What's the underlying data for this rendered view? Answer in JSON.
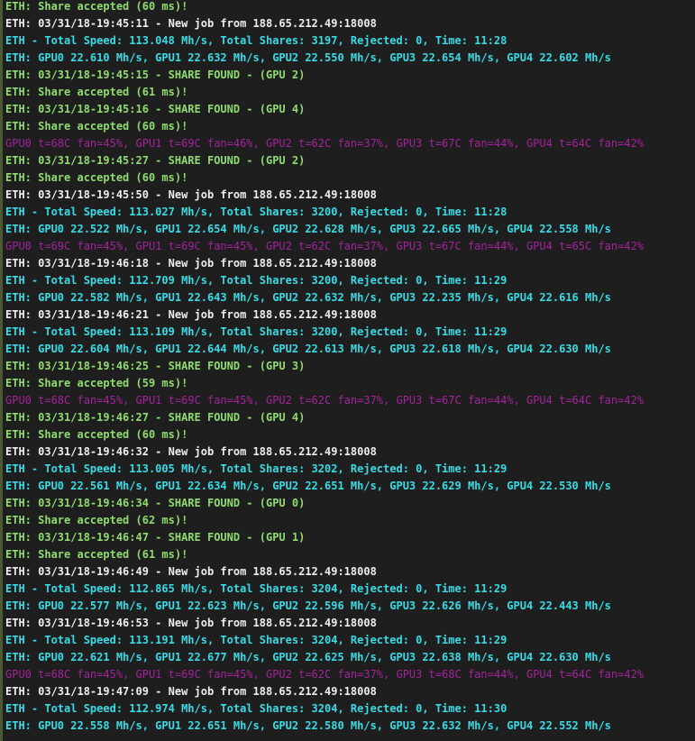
{
  "colors": {
    "background": "#1e1e1e",
    "green": "#8fdc6e",
    "white": "#eeeeee",
    "cyan": "#36dce6",
    "purple": "#a3239a"
  },
  "lines": [
    {
      "c": "green",
      "text": "ETH: Share accepted (60 ms)!"
    },
    {
      "c": "white",
      "text": "ETH: 03/31/18-19:45:11 - New job from 188.65.212.49:18008"
    },
    {
      "c": "cyan",
      "text": "ETH - Total Speed: 113.048 Mh/s, Total Shares: 3197, Rejected: 0, Time: 11:28"
    },
    {
      "c": "cyan",
      "text": "ETH: GPU0 22.610 Mh/s, GPU1 22.632 Mh/s, GPU2 22.550 Mh/s, GPU3 22.654 Mh/s, GPU4 22.602 Mh/s"
    },
    {
      "c": "green",
      "text": "ETH: 03/31/18-19:45:15 - SHARE FOUND - (GPU 2)"
    },
    {
      "c": "green",
      "text": "ETH: Share accepted (61 ms)!"
    },
    {
      "c": "green",
      "text": "ETH: 03/31/18-19:45:16 - SHARE FOUND - (GPU 4)"
    },
    {
      "c": "green",
      "text": "ETH: Share accepted (60 ms)!"
    },
    {
      "c": "purple",
      "text": "GPU0 t=68C fan=45%, GPU1 t=69C fan=46%, GPU2 t=62C fan=37%, GPU3 t=67C fan=44%, GPU4 t=64C fan=42%"
    },
    {
      "c": "green",
      "text": "ETH: 03/31/18-19:45:27 - SHARE FOUND - (GPU 2)"
    },
    {
      "c": "green",
      "text": "ETH: Share accepted (60 ms)!"
    },
    {
      "c": "white",
      "text": "ETH: 03/31/18-19:45:50 - New job from 188.65.212.49:18008"
    },
    {
      "c": "cyan",
      "text": "ETH - Total Speed: 113.027 Mh/s, Total Shares: 3200, Rejected: 0, Time: 11:28"
    },
    {
      "c": "cyan",
      "text": "ETH: GPU0 22.522 Mh/s, GPU1 22.654 Mh/s, GPU2 22.628 Mh/s, GPU3 22.665 Mh/s, GPU4 22.558 Mh/s"
    },
    {
      "c": "purple",
      "text": "GPU0 t=69C fan=45%, GPU1 t=69C fan=45%, GPU2 t=62C fan=37%, GPU3 t=67C fan=44%, GPU4 t=65C fan=42%"
    },
    {
      "c": "white",
      "text": "ETH: 03/31/18-19:46:18 - New job from 188.65.212.49:18008"
    },
    {
      "c": "cyan",
      "text": "ETH - Total Speed: 112.709 Mh/s, Total Shares: 3200, Rejected: 0, Time: 11:29"
    },
    {
      "c": "cyan",
      "text": "ETH: GPU0 22.582 Mh/s, GPU1 22.643 Mh/s, GPU2 22.632 Mh/s, GPU3 22.235 Mh/s, GPU4 22.616 Mh/s"
    },
    {
      "c": "white",
      "text": "ETH: 03/31/18-19:46:21 - New job from 188.65.212.49:18008"
    },
    {
      "c": "cyan",
      "text": "ETH - Total Speed: 113.109 Mh/s, Total Shares: 3200, Rejected: 0, Time: 11:29"
    },
    {
      "c": "cyan",
      "text": "ETH: GPU0 22.604 Mh/s, GPU1 22.644 Mh/s, GPU2 22.613 Mh/s, GPU3 22.618 Mh/s, GPU4 22.630 Mh/s"
    },
    {
      "c": "green",
      "text": "ETH: 03/31/18-19:46:25 - SHARE FOUND - (GPU 3)"
    },
    {
      "c": "green",
      "text": "ETH: Share accepted (59 ms)!"
    },
    {
      "c": "purple",
      "text": "GPU0 t=68C fan=45%, GPU1 t=69C fan=45%, GPU2 t=62C fan=37%, GPU3 t=67C fan=44%, GPU4 t=64C fan=42%"
    },
    {
      "c": "green",
      "text": "ETH: 03/31/18-19:46:27 - SHARE FOUND - (GPU 4)"
    },
    {
      "c": "green",
      "text": "ETH: Share accepted (60 ms)!"
    },
    {
      "c": "white",
      "text": "ETH: 03/31/18-19:46:32 - New job from 188.65.212.49:18008"
    },
    {
      "c": "cyan",
      "text": "ETH - Total Speed: 113.005 Mh/s, Total Shares: 3202, Rejected: 0, Time: 11:29"
    },
    {
      "c": "cyan",
      "text": "ETH: GPU0 22.561 Mh/s, GPU1 22.634 Mh/s, GPU2 22.651 Mh/s, GPU3 22.629 Mh/s, GPU4 22.530 Mh/s"
    },
    {
      "c": "green",
      "text": "ETH: 03/31/18-19:46:34 - SHARE FOUND - (GPU 0)"
    },
    {
      "c": "green",
      "text": "ETH: Share accepted (62 ms)!"
    },
    {
      "c": "green",
      "text": "ETH: 03/31/18-19:46:47 - SHARE FOUND - (GPU 1)"
    },
    {
      "c": "green",
      "text": "ETH: Share accepted (61 ms)!"
    },
    {
      "c": "white",
      "text": "ETH: 03/31/18-19:46:49 - New job from 188.65.212.49:18008"
    },
    {
      "c": "cyan",
      "text": "ETH - Total Speed: 112.865 Mh/s, Total Shares: 3204, Rejected: 0, Time: 11:29"
    },
    {
      "c": "cyan",
      "text": "ETH: GPU0 22.577 Mh/s, GPU1 22.623 Mh/s, GPU2 22.596 Mh/s, GPU3 22.626 Mh/s, GPU4 22.443 Mh/s"
    },
    {
      "c": "white",
      "text": "ETH: 03/31/18-19:46:53 - New job from 188.65.212.49:18008"
    },
    {
      "c": "cyan",
      "text": "ETH - Total Speed: 113.191 Mh/s, Total Shares: 3204, Rejected: 0, Time: 11:29"
    },
    {
      "c": "cyan",
      "text": "ETH: GPU0 22.621 Mh/s, GPU1 22.677 Mh/s, GPU2 22.625 Mh/s, GPU3 22.638 Mh/s, GPU4 22.630 Mh/s"
    },
    {
      "c": "purple",
      "text": "GPU0 t=68C fan=45%, GPU1 t=69C fan=45%, GPU2 t=62C fan=37%, GPU3 t=68C fan=44%, GPU4 t=64C fan=42%"
    },
    {
      "c": "white",
      "text": "ETH: 03/31/18-19:47:09 - New job from 188.65.212.49:18008"
    },
    {
      "c": "cyan",
      "text": "ETH - Total Speed: 112.974 Mh/s, Total Shares: 3204, Rejected: 0, Time: 11:30"
    },
    {
      "c": "cyan",
      "text": "ETH: GPU0 22.558 Mh/s, GPU1 22.651 Mh/s, GPU2 22.580 Mh/s, GPU3 22.632 Mh/s, GPU4 22.552 Mh/s"
    }
  ]
}
